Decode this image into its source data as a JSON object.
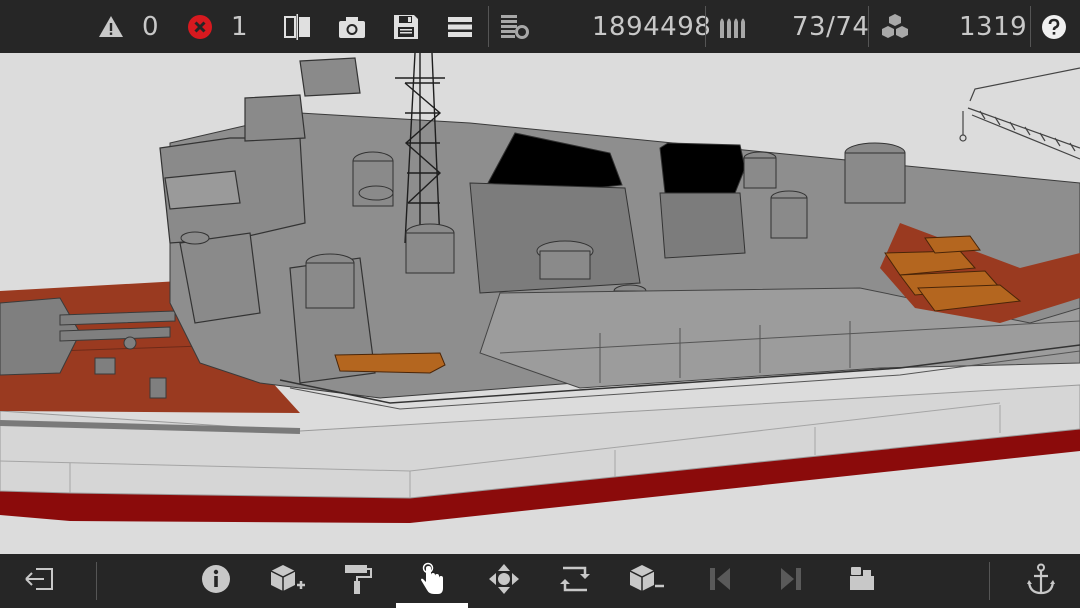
{
  "topbar": {
    "warnings": {
      "icon": "warning-icon",
      "count": "0"
    },
    "errors": {
      "icon": "error-icon",
      "count": "1"
    },
    "buttons": [
      {
        "icon": "split-view-icon"
      },
      {
        "icon": "camera-icon"
      },
      {
        "icon": "save-icon"
      },
      {
        "icon": "menu-icon"
      }
    ],
    "stats": [
      {
        "icon": "coins-icon",
        "value": "1894498"
      },
      {
        "icon": "ammo-icon",
        "value": "73/74"
      },
      {
        "icon": "blocks-icon",
        "value": "1319"
      }
    ],
    "help_icon": "help-icon"
  },
  "viewport": {
    "content": "3d-ship-model"
  },
  "bottombar": {
    "buttons": [
      {
        "icon": "exit-icon"
      },
      {
        "icon": "info-icon"
      },
      {
        "icon": "add-block-icon"
      },
      {
        "icon": "paint-roller-icon"
      },
      {
        "icon": "hand-select-icon",
        "active": true
      },
      {
        "icon": "move-icon"
      },
      {
        "icon": "rotate-icon"
      },
      {
        "icon": "remove-block-icon"
      },
      {
        "icon": "previous-icon"
      },
      {
        "icon": "next-icon"
      },
      {
        "icon": "view-camera-icon"
      },
      {
        "icon": "anchor-icon"
      }
    ]
  },
  "colors": {
    "bar_bg": "#262626",
    "text": "#c8c8c8",
    "error_red": "#d7191f",
    "hull_red": "#8b0b0b",
    "deck_brown": "#9a3a20",
    "superstructure_gray": "#8e8e8e",
    "background": "#dcdcdc"
  }
}
